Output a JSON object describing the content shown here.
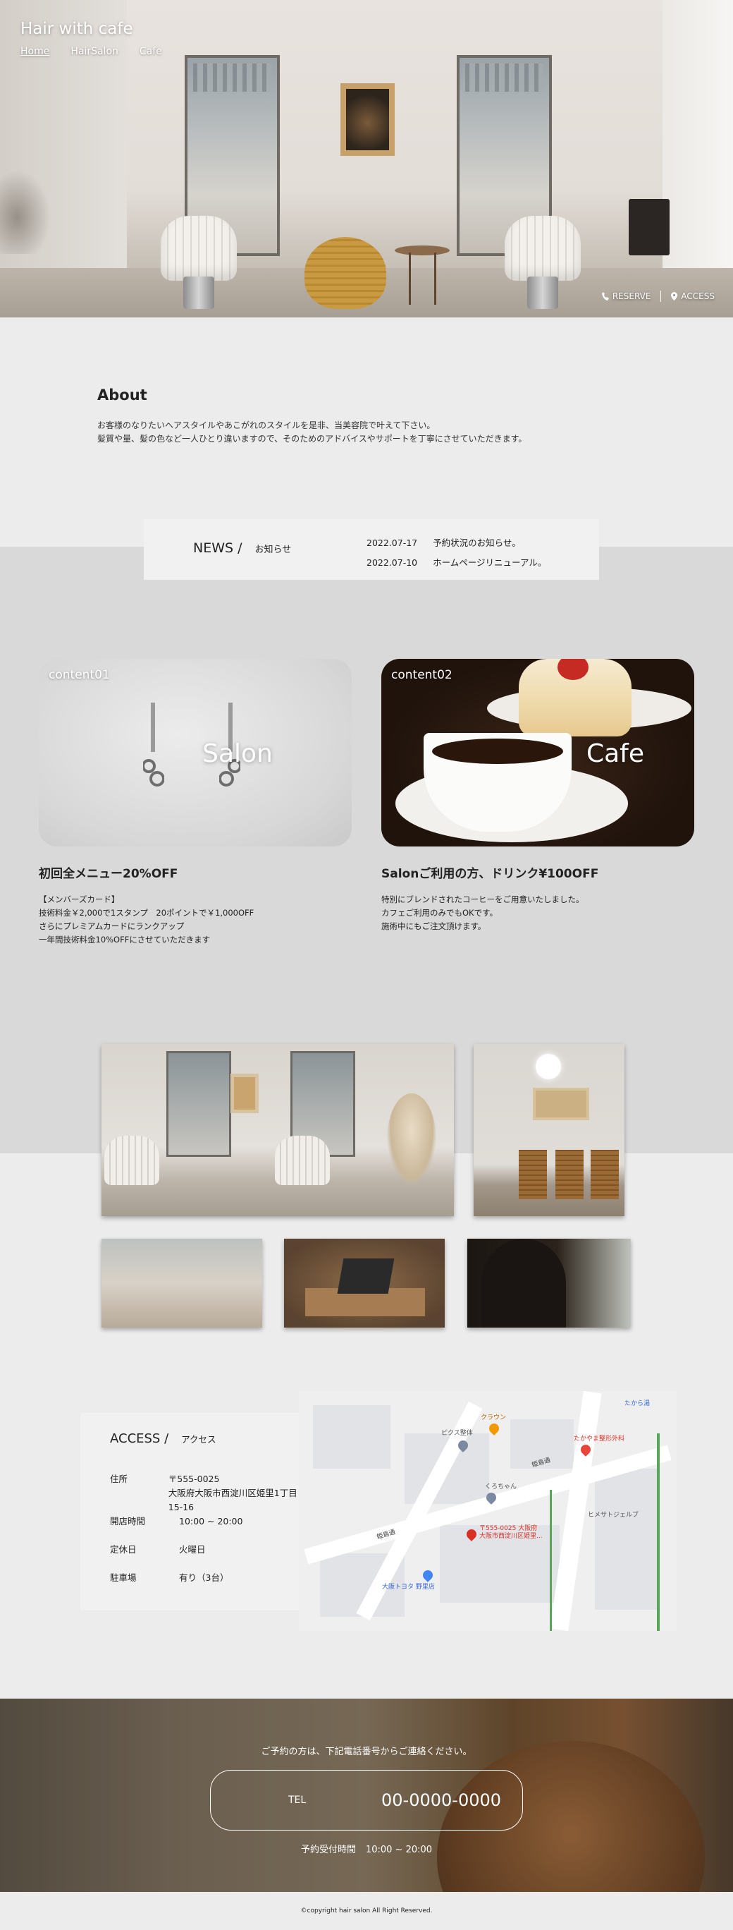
{
  "header": {
    "title": "Hair with cafe",
    "nav": [
      {
        "label": "Home",
        "active": true
      },
      {
        "label": "HairSalon",
        "active": false
      },
      {
        "label": "Cafe",
        "active": false
      }
    ],
    "actions": {
      "reserve_label": "RESERVE",
      "access_label": "ACCESS"
    }
  },
  "about": {
    "title": "About",
    "line1": "お客様のなりたいヘアスタイルやあこがれのスタイルを是非、当美容院で叶えて下さい。",
    "line2": "髪質や量、髪の色など一人ひとり違いますので、そのためのアドバイスやサポートを丁寧にさせていただきます。"
  },
  "news": {
    "title_en": "NEWS /",
    "title_jp": "お知らせ",
    "items": [
      {
        "date": "2022.07-17",
        "text": "予約状況のお知らせ。"
      },
      {
        "date": "2022.07-10",
        "text": "ホームページリニューアル。"
      }
    ]
  },
  "contents": [
    {
      "label": "content01",
      "big": "Salon",
      "title": "初回全メニュー20%OFF",
      "text": "【メンバーズカード】\n技術料金￥2,000で1スタンプ　20ポイントで￥1,000OFF\nさらにプレミアムカードにランクアップ\n一年間技術料金10%OFFにさせていただきます"
    },
    {
      "label": "content02",
      "big": "Cafe",
      "title": "Salonご利用の方、ドリンク¥100OFF",
      "text": "特別にブレンドされたコーヒーをご用意いたしました。\nカフェご利用のみでもOKです。\n施術中にもご注文頂けます。"
    }
  ],
  "access": {
    "title_en": "ACCESS /",
    "title_jp": "アクセス",
    "rows": [
      {
        "key": "住所",
        "value": "〒555-0025\n大阪府大阪市西淀川区姫里1丁目15-16"
      },
      {
        "key": "開店時間",
        "value": "10:00 ~ 20:00"
      },
      {
        "key": "定休日",
        "value": "火曜日"
      },
      {
        "key": "駐車場",
        "value": "有り（3台）"
      }
    ],
    "map": {
      "road1": "姫島通",
      "road2": "姫島通",
      "pin_address": "〒555-0025 大阪府\n大阪市西淀川区姫里...",
      "poi1": "たかやま整形外科",
      "poi2": "クラウン",
      "poi3": "ピクス整体",
      "poi4": "ヒメサトジェルブ",
      "poi5": "大阪トヨタ 野里店",
      "poi6": "たから湯",
      "poi7": "くろちゃん"
    }
  },
  "reserve": {
    "note": "ご予約の方は、下記電話番号からご連絡ください。",
    "tel_label": "TEL",
    "tel_number": "00-0000-0000",
    "hours_label": "予約受付時間",
    "hours_value": "10:00 ~ 20:00"
  },
  "footer": {
    "copyright": "©copyright hair salon All Right Reserved."
  }
}
